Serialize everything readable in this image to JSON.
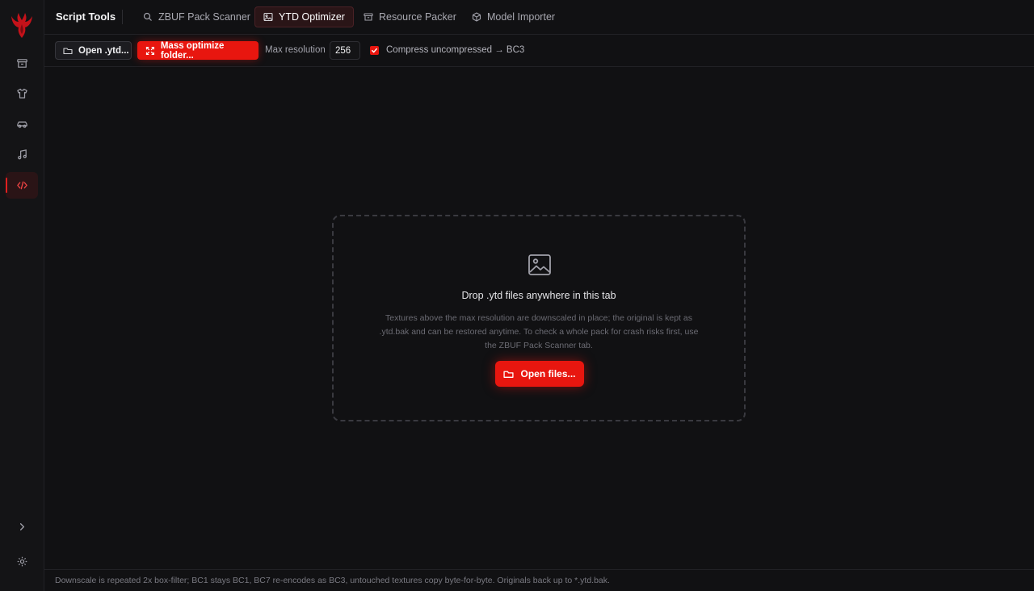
{
  "colors": {
    "accent": "#e8160f",
    "background": "#111113",
    "sidebar": "#141416"
  },
  "sidebar": {
    "logo_icon": "phoenix-logo-icon",
    "items": [
      {
        "icon": "archive-icon"
      },
      {
        "icon": "shirt-icon"
      },
      {
        "icon": "car-icon"
      },
      {
        "icon": "music-note-icon"
      },
      {
        "icon": "code-icon",
        "active": true
      }
    ],
    "bottom": [
      {
        "icon": "chevron-right-icon"
      },
      {
        "icon": "gear-icon"
      }
    ]
  },
  "header": {
    "title": "Script Tools",
    "tabs": [
      {
        "label": "ZBUF Pack Scanner",
        "icon": "search-icon"
      },
      {
        "label": "YTD Optimizer",
        "icon": "image-icon",
        "active": true
      },
      {
        "label": "Resource Packer",
        "icon": "archive-icon"
      },
      {
        "label": "Model Importer",
        "icon": "cube-icon"
      }
    ]
  },
  "toolbar": {
    "open_label": "Open .ytd...",
    "mass_label": "Mass optimize folder...",
    "max_res_label": "Max resolution",
    "max_res_value": "256",
    "compress_label": "Compress uncompressed → BC3",
    "compress_checked": true
  },
  "dropzone": {
    "title": "Drop .ytd files anywhere in this tab",
    "description": "Textures above the max resolution are downscaled in place; the original is kept as .ytd.bak and can be restored anytime. To check a whole pack for crash risks first, use the ZBUF Pack Scanner tab.",
    "button_label": "Open files..."
  },
  "footer": {
    "text": "Downscale is repeated 2x box-filter; BC1 stays BC1, BC7 re-encodes as BC3, untouched textures copy byte-for-byte. Originals back up to *.ytd.bak."
  }
}
